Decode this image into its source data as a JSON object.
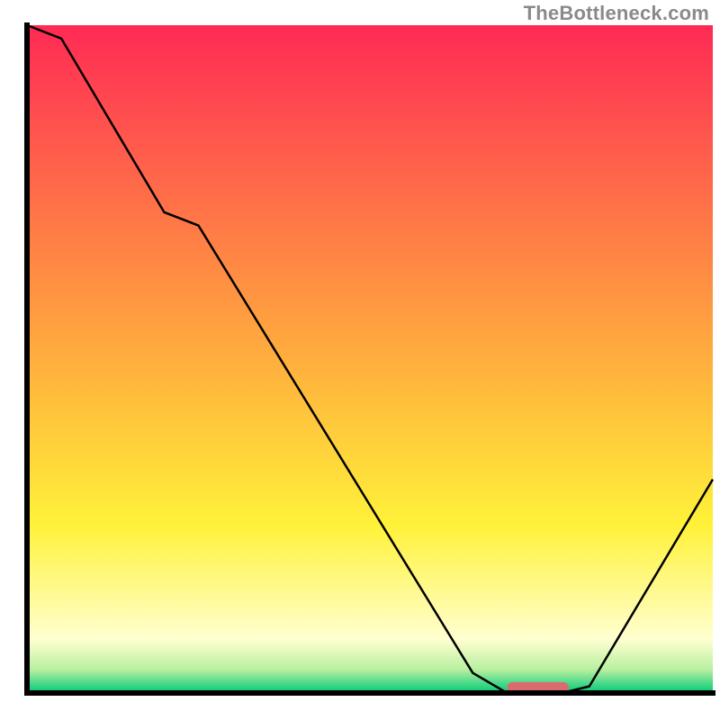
{
  "watermark": "TheBottleneck.com",
  "chart_data": {
    "type": "line",
    "title": "",
    "xlabel": "",
    "ylabel": "",
    "xlim": [
      0,
      100
    ],
    "ylim": [
      0,
      100
    ],
    "x": [
      0,
      5,
      20,
      25,
      65,
      70,
      78,
      82,
      100
    ],
    "values": [
      100,
      98,
      72,
      70,
      3,
      0,
      0,
      1,
      32
    ],
    "optimum_marker": {
      "x_start": 70,
      "x_end": 79,
      "color": "#d96b6e"
    },
    "gradient_stops": [
      {
        "pos": 0.0,
        "color": "#ff2a55"
      },
      {
        "pos": 0.5,
        "color": "#ffae3d"
      },
      {
        "pos": 0.75,
        "color": "#fff23a"
      },
      {
        "pos": 0.92,
        "color": "#ffffd0"
      },
      {
        "pos": 0.965,
        "color": "#b8f0a0"
      },
      {
        "pos": 0.985,
        "color": "#4cd98a"
      },
      {
        "pos": 1.0,
        "color": "#00cc73"
      }
    ],
    "line_color": "#000000",
    "axis_color": "#000000",
    "background": "#ffffff"
  }
}
